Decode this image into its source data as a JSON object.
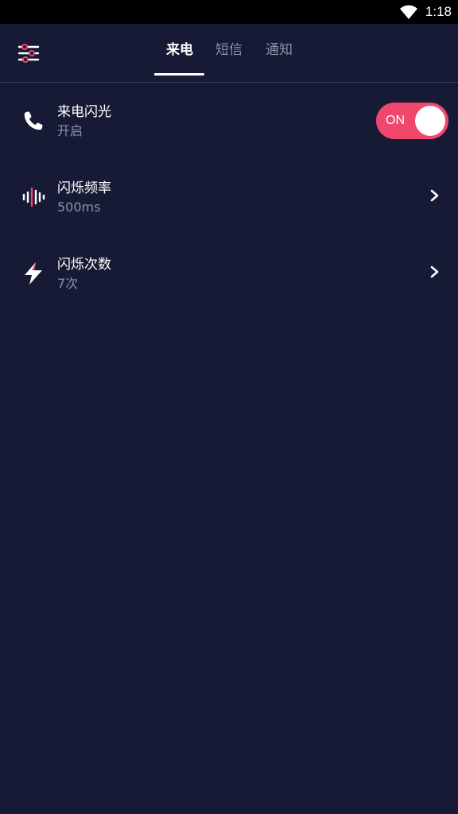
{
  "status_bar": {
    "time": "1:18",
    "wifi_icon": "wifi-icon"
  },
  "app_bar": {
    "menu_icon": "settings-sliders-icon",
    "tabs": [
      {
        "label": "来电",
        "selected": true
      },
      {
        "label": "短信",
        "selected": false
      },
      {
        "label": "通知",
        "selected": false
      }
    ]
  },
  "settings": [
    {
      "icon": "phone-icon",
      "title": "来电闪光",
      "subtitle": "开启",
      "control": "toggle",
      "toggle_label": "ON",
      "toggle_on": true
    },
    {
      "icon": "sound-wave-icon",
      "title": "闪烁频率",
      "subtitle": "500ms",
      "control": "chevron"
    },
    {
      "icon": "lightning-icon",
      "title": "闪烁次数",
      "subtitle": "7次",
      "control": "chevron"
    }
  ],
  "colors": {
    "background": "#161a35",
    "accent": "#f0476d",
    "secondary_text": "#8d90a6",
    "status_bar": "#000000"
  }
}
